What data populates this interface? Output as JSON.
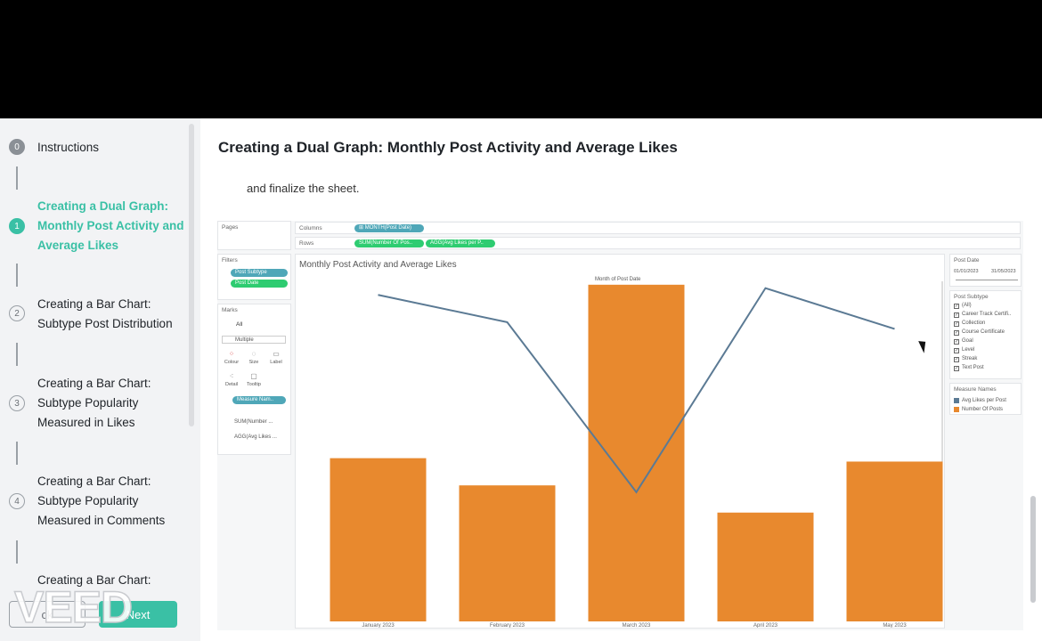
{
  "sidebar": {
    "steps": [
      {
        "num": "0",
        "label": "Instructions",
        "state": "filled"
      },
      {
        "num": "1",
        "label": "Creating a Dual Graph: Monthly Post Activity and Average Likes",
        "state": "active"
      },
      {
        "num": "2",
        "label": "Creating a Bar Chart: Subtype Post Distribution",
        "state": "default"
      },
      {
        "num": "3",
        "label": "Creating a Bar Chart: Subtype Popularity Measured in Likes",
        "state": "default"
      },
      {
        "num": "4",
        "label": "Creating a Bar Chart: Subtype Popularity Measured in Comments",
        "state": "default"
      },
      {
        "num": "",
        "label": "Creating a Bar Chart:",
        "state": "default"
      }
    ],
    "back_label": "ck",
    "next_label": "Next",
    "watermark": "VEED"
  },
  "main": {
    "title": "Creating a Dual Graph: Monthly Post Activity and Average Likes",
    "paragraph": "and finalize the sheet."
  },
  "tableau": {
    "pages_label": "Pages",
    "columns_label": "Columns",
    "rows_label": "Rows",
    "columns_pill": "⊞ MONTH(Post Date)",
    "rows_pills": [
      "SUM(Number Of Pos..",
      "AGG(Avg Likes per P.."
    ],
    "filters_label": "Filters",
    "filter_pills": [
      "Post Subtype",
      "Post Date"
    ],
    "marks_label": "Marks",
    "marks_all": "All",
    "marks_type": "Multiple",
    "mark_buttons": [
      "Colour",
      "Size",
      "Label",
      "Detail",
      "Tooltip"
    ],
    "marks_measure_pill": "Measure Nam..",
    "marks_rows": [
      "SUM(Number ...",
      "AGG(Avg Likes ..."
    ],
    "sheet_title": "Monthly Post Activity and Average Likes",
    "post_date_label": "Post Date",
    "date_from": "01/01/2023",
    "date_to": "31/05/2023",
    "post_subtype_label": "Post Subtype",
    "subtypes": [
      "(All)",
      "Career Track Certifi..",
      "Collection",
      "Course Certificate",
      "Goal",
      "Level",
      "Streak",
      "Text Post"
    ],
    "measure_names_label": "Measure Names",
    "legend": [
      {
        "name": "Avg Likes per Post",
        "color": "#5b7a94"
      },
      {
        "name": "Number Of Posts",
        "color": "#e8892e"
      }
    ]
  },
  "chart_data": {
    "type": "bar",
    "xlabel": "Month of Post Date",
    "categories": [
      "January 2023",
      "February 2023",
      "March 2023",
      "April 2023",
      "May 2023"
    ],
    "series": [
      {
        "name": "Number Of Posts",
        "chart": "bar",
        "color": "#e8892e",
        "values": [
          48,
          40,
          99,
          32,
          47
        ]
      },
      {
        "name": "Avg Likes per Post",
        "chart": "line",
        "color": "#5b7a94",
        "values": [
          96,
          88,
          38,
          98,
          86
        ]
      }
    ],
    "ylim": [
      0,
      100
    ],
    "grid": false
  }
}
